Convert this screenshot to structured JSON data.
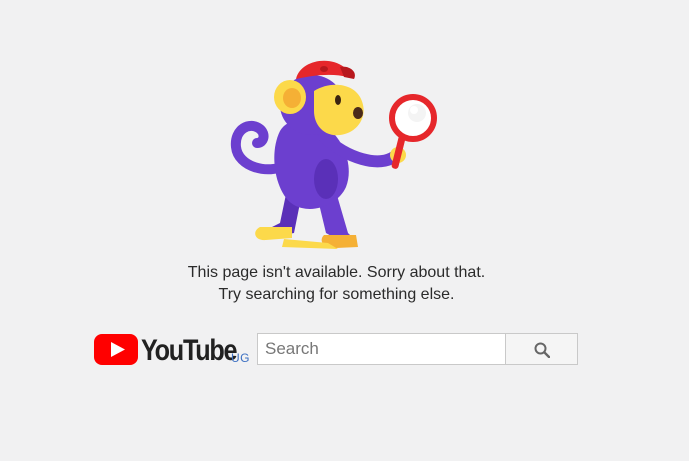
{
  "illustration": {
    "icon": "monkey-with-magnifying-glass-icon"
  },
  "message": {
    "line1": "This page isn't available. Sorry about that.",
    "line2": "Try searching for something else."
  },
  "logo": {
    "wordmark": "YouTube",
    "region": "UG",
    "icon": "youtube-play-icon"
  },
  "search": {
    "placeholder": "Search",
    "value": "",
    "button_icon": "search-icon"
  },
  "colors": {
    "background": "#f1f1f2",
    "brand_red": "#ff0000",
    "region_blue": "#3b6fc2",
    "monkey_purple": "#6c3fcf",
    "monkey_yellow": "#fcd94a",
    "cap_red": "#e6272b"
  }
}
